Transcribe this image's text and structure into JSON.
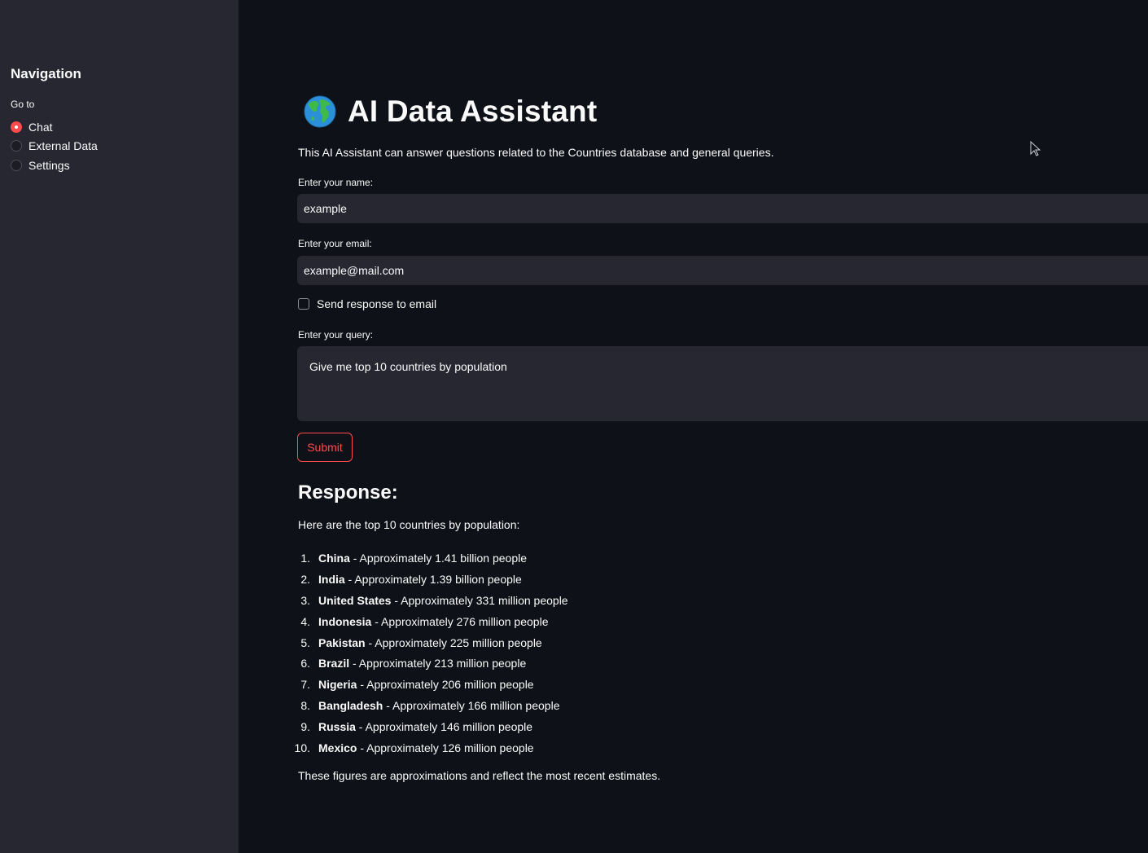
{
  "sidebar": {
    "title": "Navigation",
    "radio_label": "Go to",
    "options": [
      {
        "label": "Chat",
        "selected": true
      },
      {
        "label": "External Data",
        "selected": false
      },
      {
        "label": "Settings",
        "selected": false
      }
    ]
  },
  "main": {
    "icon": "globe-icon",
    "title": "AI Data Assistant",
    "description": "This AI Assistant can answer questions related to the Countries database and general queries.",
    "name_field": {
      "label": "Enter your name:",
      "value": "example"
    },
    "email_field": {
      "label": "Enter your email:",
      "value": "example@mail.com"
    },
    "send_email_checkbox": {
      "label": "Send response to email",
      "checked": false
    },
    "query_field": {
      "label": "Enter your query:",
      "value": "Give me top 10 countries by population"
    },
    "submit_label": "Submit",
    "response": {
      "heading": "Response:",
      "intro": "Here are the top 10 countries by population:",
      "items": [
        {
          "num": "1.",
          "country": "China",
          "text": " - Approximately 1.41 billion people"
        },
        {
          "num": "2.",
          "country": "India",
          "text": " - Approximately 1.39 billion people"
        },
        {
          "num": "3.",
          "country": "United States",
          "text": " - Approximately 331 million people"
        },
        {
          "num": "4.",
          "country": "Indonesia",
          "text": " - Approximately 276 million people"
        },
        {
          "num": "5.",
          "country": "Pakistan",
          "text": " - Approximately 225 million people"
        },
        {
          "num": "6.",
          "country": "Brazil",
          "text": " - Approximately 213 million people"
        },
        {
          "num": "7.",
          "country": "Nigeria",
          "text": " - Approximately 206 million people"
        },
        {
          "num": "8.",
          "country": "Bangladesh",
          "text": " - Approximately 166 million people"
        },
        {
          "num": "9.",
          "country": "Russia",
          "text": " - Approximately 146 million people"
        },
        {
          "num": "10.",
          "country": "Mexico",
          "text": " - Approximately 126 million people"
        }
      ],
      "outro": "These figures are approximations and reflect the most recent estimates."
    }
  },
  "colors": {
    "background": "#0e1117",
    "sidebar": "#262730",
    "input": "#262730",
    "accent": "#ff4b4b",
    "text": "#fafafa"
  }
}
